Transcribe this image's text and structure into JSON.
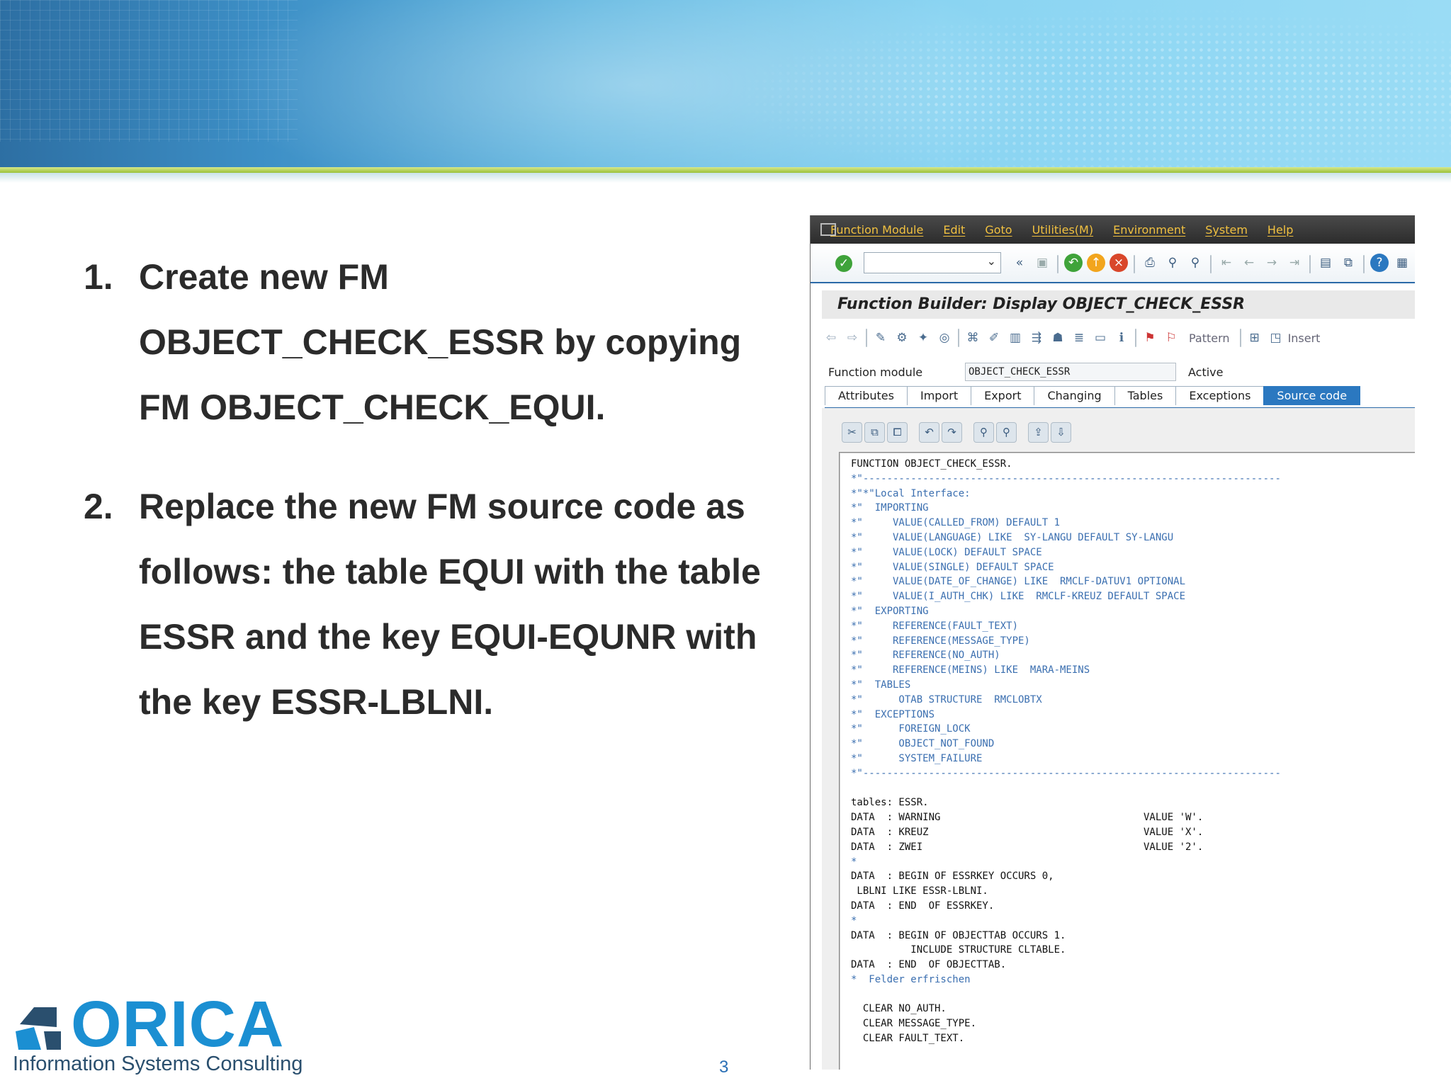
{
  "slide": {
    "items": [
      {
        "num": "1.",
        "lines": [
          "Create new FM",
          "OBJECT_CHECK_ESSR by copying",
          "FM OBJECT_CHECK_EQUI."
        ]
      },
      {
        "num": "2.",
        "lines": [
          "Replace the new FM source code as",
          "follows: the table EQUI with the table",
          "ESSR and the key EQUI-EQUNR with",
          "the key ESSR-LBLNI."
        ]
      }
    ],
    "page_number": "3",
    "logo": {
      "word": "ORICA",
      "tagline": "Information Systems Consulting"
    },
    "colors": {
      "banner": "#3d8fc6",
      "accent_green": "#9bc13a",
      "logo_blue": "#1b8fd2"
    }
  },
  "sap": {
    "menu": [
      "Function Module",
      "Edit",
      "Goto",
      "Utilities(M)",
      "Environment",
      "System",
      "Help"
    ],
    "title": "Function Builder: Display OBJECT_CHECK_ESSR",
    "toolbar_texts": {
      "pattern": "Pattern",
      "insert": "Insert"
    },
    "fm": {
      "label": "Function module",
      "value": "OBJECT_CHECK_ESSR",
      "status": "Active"
    },
    "tabs": [
      "Attributes",
      "Import",
      "Export",
      "Changing",
      "Tables",
      "Exceptions",
      "Source code"
    ],
    "active_tab": "Source code",
    "icons": {
      "toolbar1": [
        "enter-check-icon",
        "back-icon",
        "save-icon",
        "back-green-icon",
        "exit-icon",
        "cancel-icon",
        "print-icon",
        "find-icon",
        "find-next-icon",
        "first-page-icon",
        "previous-page-icon",
        "next-page-icon",
        "last-page-icon",
        "new-session-icon",
        "shortcut-icon",
        "help-icon",
        "layout-icon"
      ],
      "toolbar2": [
        "back-arrow-icon",
        "forward-arrow-icon",
        "change-icon",
        "display-change-icon",
        "activate-icon",
        "check-icon",
        "where-used-icon",
        "edit-object-icon",
        "navigate-icon",
        "hierarchy-icon",
        "stack-icon",
        "frame-icon",
        "info-icon",
        "test-icon",
        "debug-icon",
        "pattern-icon",
        "insert-icon"
      ],
      "editor": [
        "cut-icon",
        "copy-icon",
        "paste-icon",
        "undo-icon",
        "redo-icon",
        "search-icon",
        "search-next-icon",
        "upload-icon",
        "download-icon"
      ]
    },
    "code": [
      "FUNCTION OBJECT_CHECK_ESSR.",
      "*\"----------------------------------------------------------------------",
      "*\"*\"Local Interface:",
      "*\"  IMPORTING",
      "*\"     VALUE(CALLED_FROM) DEFAULT 1",
      "*\"     VALUE(LANGUAGE) LIKE  SY-LANGU DEFAULT SY-LANGU",
      "*\"     VALUE(LOCK) DEFAULT SPACE",
      "*\"     VALUE(SINGLE) DEFAULT SPACE",
      "*\"     VALUE(DATE_OF_CHANGE) LIKE  RMCLF-DATUV1 OPTIONAL",
      "*\"     VALUE(I_AUTH_CHK) LIKE  RMCLF-KREUZ DEFAULT SPACE",
      "*\"  EXPORTING",
      "*\"     REFERENCE(FAULT_TEXT)",
      "*\"     REFERENCE(MESSAGE_TYPE)",
      "*\"     REFERENCE(NO_AUTH)",
      "*\"     REFERENCE(MEINS) LIKE  MARA-MEINS",
      "*\"  TABLES",
      "*\"      OTAB STRUCTURE  RMCLOBTX",
      "*\"  EXCEPTIONS",
      "*\"      FOREIGN_LOCK",
      "*\"      OBJECT_NOT_FOUND",
      "*\"      SYSTEM_FAILURE",
      "*\"----------------------------------------------------------------------",
      "",
      "tables: ESSR.",
      "DATA  : WARNING                                  VALUE 'W'.",
      "DATA  : KREUZ                                    VALUE 'X'.",
      "DATA  : ZWEI                                     VALUE '2'.",
      "*",
      "DATA  : BEGIN OF ESSRKEY OCCURS 0,",
      " LBLNI LIKE ESSR-LBLNI.",
      "DATA  : END  OF ESSRKEY.",
      "*",
      "DATA  : BEGIN OF OBJECTTAB OCCURS 1.",
      "          INCLUDE STRUCTURE CLTABLE.",
      "DATA  : END  OF OBJECTTAB.",
      "*  Felder erfrischen",
      "",
      "  CLEAR NO_AUTH.",
      "  CLEAR MESSAGE_TYPE.",
      "  CLEAR FAULT_TEXT."
    ]
  }
}
